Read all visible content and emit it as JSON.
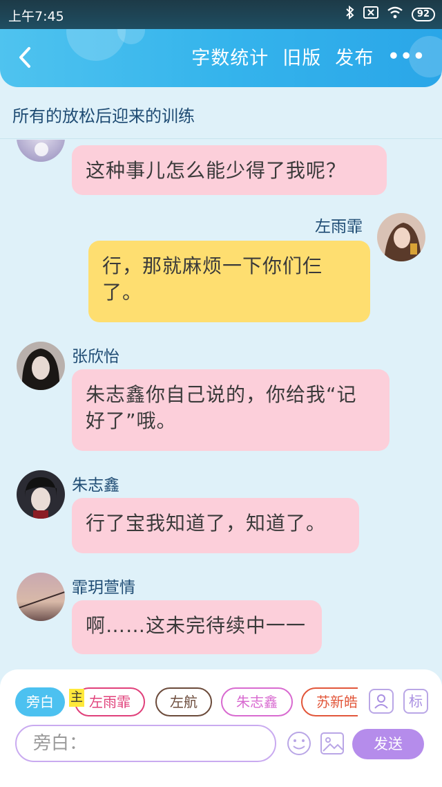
{
  "status_bar": {
    "time": "上午7:45",
    "battery": "92"
  },
  "header": {
    "word_count_label": "字数统计",
    "old_version_label": "旧版",
    "publish_label": "发布",
    "more_label": "•••"
  },
  "story_title": "所有的放松后迎来的训练",
  "messages": [
    {
      "speaker": "",
      "text": "这种事儿怎么能少得了我呢？",
      "side": "left",
      "color": "pink"
    },
    {
      "speaker": "左雨霏",
      "text": "行，那就麻烦一下你们仨了。",
      "side": "right",
      "color": "yellow"
    },
    {
      "speaker": "张欣怡",
      "text": "朱志鑫你自己说的，你给我“记好了”哦。",
      "side": "left",
      "color": "pink"
    },
    {
      "speaker": "朱志鑫",
      "text": "行了宝我知道了，知道了。",
      "side": "left",
      "color": "pink"
    },
    {
      "speaker": "霏玥萱情",
      "text": "啊……这未完待续中一一",
      "side": "left",
      "color": "pink"
    }
  ],
  "composer": {
    "chips": [
      {
        "label": "旁白",
        "color": "#4cc1f0"
      },
      {
        "label": "左雨霏",
        "color": "#e0407a"
      },
      {
        "label": "左航",
        "color": "#6b4a3a"
      },
      {
        "label": "朱志鑫",
        "color": "#d86ad0"
      },
      {
        "label": "苏新皓",
        "color": "#e2563a"
      }
    ],
    "main_tag": "主",
    "tag_button": "标",
    "input_placeholder": "旁白：",
    "send_label": "发送"
  }
}
